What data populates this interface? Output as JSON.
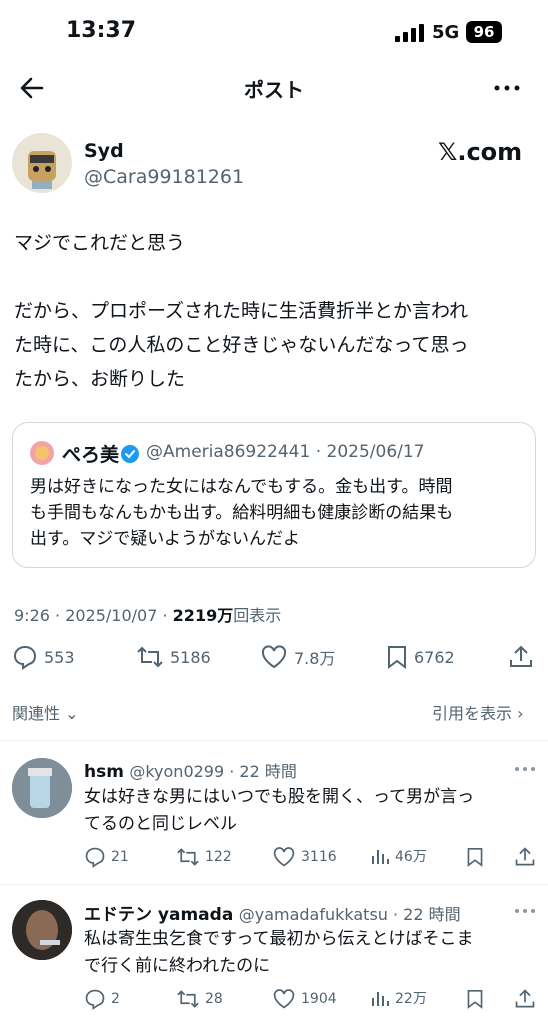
{
  "status": {
    "time": "13:37",
    "network": "5G",
    "battery": "96"
  },
  "header": {
    "title": "ポスト"
  },
  "post": {
    "name": "Syd",
    "handle": "@Cara99181261",
    "watermark": "𝕏.com",
    "lines": [
      "マジでこれだと思う",
      "",
      "だから、プロポーズされた時に生活費折半とか言われ",
      "た時に、この人私のこと好きじゃないんだなって思っ",
      "たから、お断りした"
    ],
    "quote": {
      "name": "ぺろ美",
      "handle_date": "@Ameria86922441 · 2025/06/17",
      "lines": [
        "男は好きになった女にはなんでもする。金も出す。時間",
        "も手間もなんもかも出す。給料明細も健康診断の結果も",
        "出す。マジで疑いようがないんだよ"
      ]
    },
    "time_date": "9:26 · 2025/10/07 · ",
    "views_count": "2219万",
    "views_label": "回表示",
    "stats": {
      "replies": "553",
      "reposts": "5186",
      "likes": "7.8万",
      "bookmarks": "6762"
    }
  },
  "sort": {
    "label": "関連性",
    "quotes_label": "引用を表示"
  },
  "replies": [
    {
      "name": "hsm",
      "handle_time": "@kyon0299 · 22 時間",
      "lines": [
        "女は好きな男にはいつでも股を開く、って男が言っ",
        "てるのと同じレベル"
      ],
      "replies": "21",
      "reposts": "122",
      "likes": "3116",
      "views": "46万"
    },
    {
      "name": "エドテン yamada",
      "handle_time": "@yamadafukkatsu · 22 時間",
      "lines": [
        "私は寄生虫乞食ですって最初から伝えとけばそこま",
        "で行く前に終われたのに"
      ],
      "replies": "2",
      "reposts": "28",
      "likes": "1904",
      "views": "22万"
    }
  ],
  "colors": {
    "verified": "#1d9bf0",
    "muted": "#536471"
  }
}
